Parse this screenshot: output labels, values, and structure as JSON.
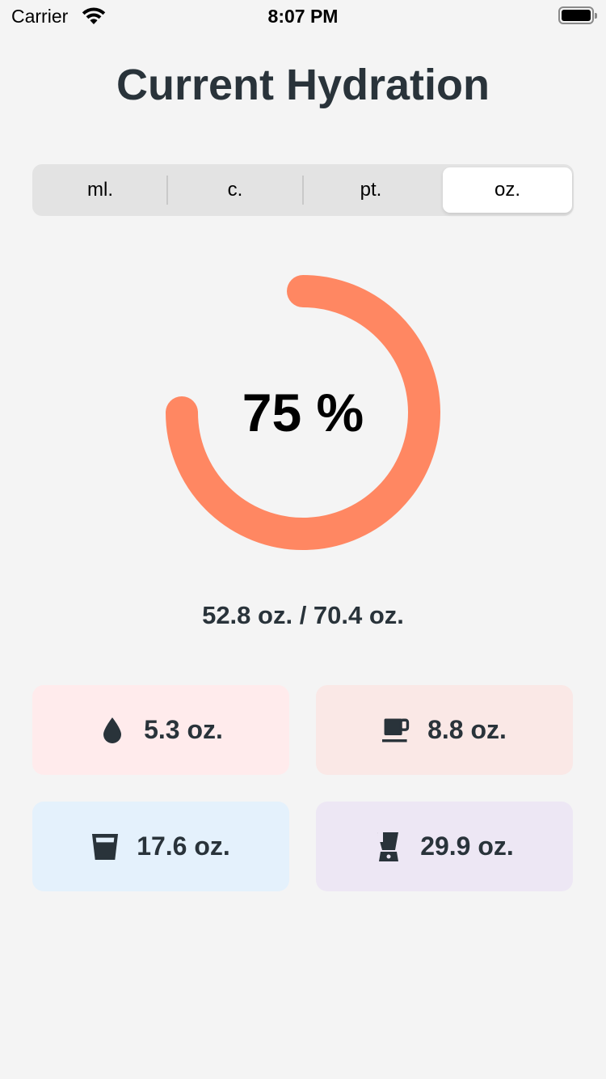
{
  "status_bar": {
    "carrier": "Carrier",
    "time": "8:07 PM"
  },
  "title": "Current Hydration",
  "units": {
    "options": [
      "ml.",
      "c.",
      "pt.",
      "oz."
    ],
    "selected": "oz."
  },
  "progress": {
    "label": "75 %",
    "fraction": 0.75,
    "color": "#ff8762",
    "current": "52.8 oz.",
    "goal": "70.4 oz.",
    "totals_text": "52.8 oz. / 70.4 oz."
  },
  "drinks": [
    {
      "name": "water",
      "icon": "water-drop-icon",
      "value": "5.3 oz.",
      "color": "#ffebec"
    },
    {
      "name": "coffee",
      "icon": "coffee-cup-icon",
      "value": "8.8 oz.",
      "color": "#fae8e6"
    },
    {
      "name": "glass",
      "icon": "glass-icon",
      "value": "17.6 oz.",
      "color": "#e4f1fc"
    },
    {
      "name": "smoothie",
      "icon": "blender-icon",
      "value": "29.9 oz.",
      "color": "#ede7f4"
    }
  ],
  "colors": {
    "background": "#f4f4f4",
    "text": "#29333a"
  }
}
